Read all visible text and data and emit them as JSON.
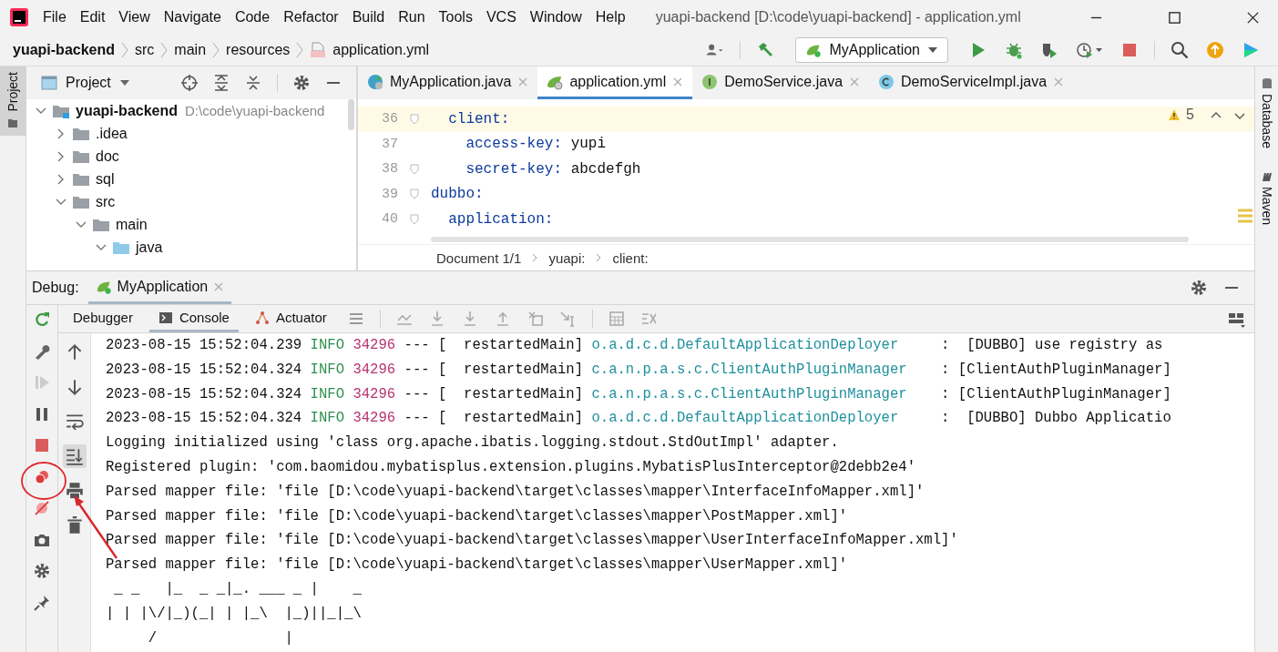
{
  "window": {
    "title": "yuapi-backend [D:\\code\\yuapi-backend] - application.yml"
  },
  "menu": [
    "File",
    "Edit",
    "View",
    "Navigate",
    "Code",
    "Refactor",
    "Build",
    "Run",
    "Tools",
    "VCS",
    "Window",
    "Help"
  ],
  "breadcrumbs": [
    "yuapi-backend",
    "src",
    "main",
    "resources",
    "application.yml"
  ],
  "run_config": "MyApplication",
  "left_stripe": [
    {
      "label": "Project",
      "selected": true
    }
  ],
  "right_stripe": [
    {
      "label": "Database"
    },
    {
      "label": "Maven"
    }
  ],
  "project_panel": {
    "title": "Project",
    "tree": [
      {
        "label": "yuapi-backend",
        "hint": "D:\\code\\yuapi-backend",
        "kind": "module",
        "expanded": true,
        "children": [
          {
            "label": ".idea",
            "kind": "folder",
            "expanded": false
          },
          {
            "label": "doc",
            "kind": "folder",
            "expanded": false
          },
          {
            "label": "sql",
            "kind": "folder",
            "expanded": false
          },
          {
            "label": "src",
            "kind": "folder",
            "expanded": true,
            "children": [
              {
                "label": "main",
                "kind": "folder",
                "expanded": true,
                "children": [
                  {
                    "label": "java",
                    "kind": "source",
                    "expanded": true
                  }
                ]
              }
            ]
          }
        ]
      }
    ]
  },
  "editor": {
    "tabs": [
      {
        "label": "MyApplication.java",
        "kind": "runnable-class",
        "selected": false
      },
      {
        "label": "application.yml",
        "kind": "spring-config",
        "selected": true
      },
      {
        "label": "DemoService.java",
        "kind": "interface",
        "selected": false
      },
      {
        "label": "DemoServiceImpl.java",
        "kind": "class",
        "selected": false
      }
    ],
    "warnings": "5",
    "lines": [
      {
        "number": "36",
        "key": "  client:",
        "current": true,
        "fold": true
      },
      {
        "number": "37",
        "key": "    access-key:",
        "value": " yupi",
        "current": false,
        "fold": false
      },
      {
        "number": "38",
        "key": "    secret-key:",
        "value": " abcdefgh",
        "current": false,
        "fold": true
      },
      {
        "number": "39",
        "key": "dubbo:",
        "current": false,
        "fold": true
      },
      {
        "number": "40",
        "key": "  application:",
        "current": false,
        "fold": true
      }
    ],
    "breadcrumbs": [
      "Document 1/1",
      "yuapi:",
      "client:"
    ]
  },
  "debug": {
    "label": "Debug:",
    "session": "MyApplication",
    "tabs": [
      {
        "label": "Debugger",
        "kind": "plain",
        "selected": false
      },
      {
        "label": "Console",
        "kind": "console",
        "selected": true
      },
      {
        "label": "Actuator",
        "kind": "actuator",
        "selected": false
      }
    ],
    "console": [
      {
        "kind": "log",
        "time": "2023-08-15 15:52:04.239",
        "level": "INFO",
        "pid": "34296",
        "thread": "--- [  restartedMain]",
        "logger": "o.a.d.c.d.DefaultApplicationDeployer",
        "message": ":  [DUBBO] use registry as"
      },
      {
        "kind": "log",
        "time": "2023-08-15 15:52:04.324",
        "level": "INFO",
        "pid": "34296",
        "thread": "--- [  restartedMain]",
        "logger": "c.a.n.p.a.s.c.ClientAuthPluginManager",
        "message": ": [ClientAuthPluginManager]"
      },
      {
        "kind": "log",
        "time": "2023-08-15 15:52:04.324",
        "level": "INFO",
        "pid": "34296",
        "thread": "--- [  restartedMain]",
        "logger": "c.a.n.p.a.s.c.ClientAuthPluginManager",
        "message": ": [ClientAuthPluginManager]"
      },
      {
        "kind": "log",
        "time": "2023-08-15 15:52:04.324",
        "level": "INFO",
        "pid": "34296",
        "thread": "--- [  restartedMain]",
        "logger": "o.a.d.c.d.DefaultApplicationDeployer",
        "message": ":  [DUBBO] Dubbo Applicatio"
      },
      {
        "kind": "text",
        "text": "Logging initialized using 'class org.apache.ibatis.logging.stdout.StdOutImpl' adapter."
      },
      {
        "kind": "text",
        "text": "Registered plugin: 'com.baomidou.mybatisplus.extension.plugins.MybatisPlusInterceptor@2debb2e4'"
      },
      {
        "kind": "text",
        "text": "Parsed mapper file: 'file [D:\\code\\yuapi-backend\\target\\classes\\mapper\\InterfaceInfoMapper.xml]'"
      },
      {
        "kind": "text",
        "text": "Parsed mapper file: 'file [D:\\code\\yuapi-backend\\target\\classes\\mapper\\PostMapper.xml]'"
      },
      {
        "kind": "text",
        "text": "Parsed mapper file: 'file [D:\\code\\yuapi-backend\\target\\classes\\mapper\\UserInterfaceInfoMapper.xml]'"
      },
      {
        "kind": "text",
        "text": "Parsed mapper file: 'file [D:\\code\\yuapi-backend\\target\\classes\\mapper\\UserMapper.xml]'"
      },
      {
        "kind": "text",
        "text": " _ _   |_  _ _|_. ___ _ |    _"
      },
      {
        "kind": "text",
        "text": "| | |\\/|_)(_| | |_\\  |_)||_|_\\"
      },
      {
        "kind": "text",
        "text": "     /               |"
      }
    ]
  },
  "annotations": {
    "highlight_circle": true,
    "pointer_arrow": true
  }
}
